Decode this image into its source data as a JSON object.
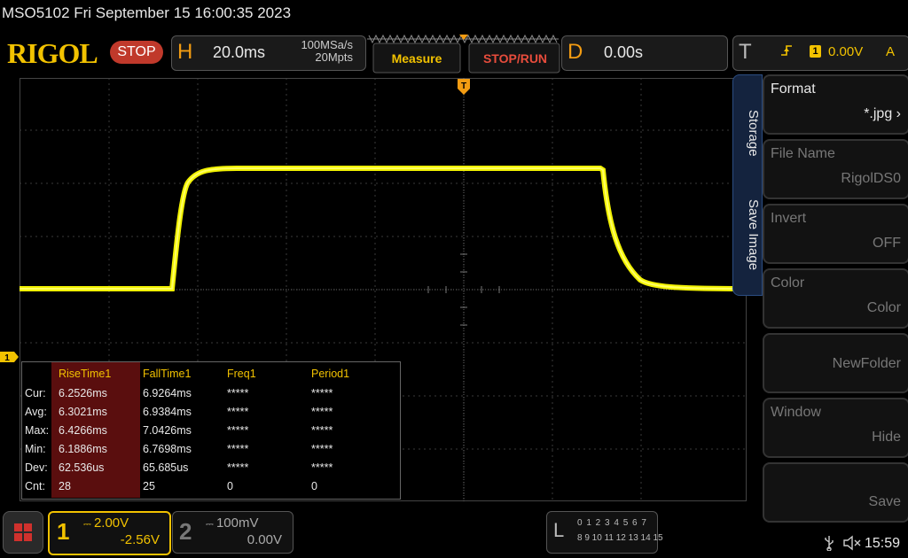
{
  "title": "MSO5102  Fri September 15 16:00:35 2023",
  "topbar": {
    "logo": "RIGOL",
    "run_state": "STOP",
    "horizontal": {
      "letter": "H",
      "timebase": "20.0ms",
      "sample_rate": "100MSa/s",
      "memory_depth": "20Mpts"
    },
    "measure_label": "Measure",
    "stop_run_label": "STOP/RUN",
    "delay": {
      "letter": "D",
      "value": "0.00s"
    },
    "trigger": {
      "letter": "T",
      "edge_symbol": "⫯",
      "channel": "1",
      "level": "0.00V",
      "mode": "A"
    }
  },
  "side_panel": {
    "tabs": [
      "Storage",
      "Save Image"
    ],
    "buttons": [
      {
        "label": "Format",
        "value": "*.jpg",
        "enabled": true
      },
      {
        "label": "File Name",
        "value": "RigolDS0",
        "enabled": false
      },
      {
        "label": "Invert",
        "value": "OFF",
        "enabled": false
      },
      {
        "label": "Color",
        "value": "Color",
        "enabled": false
      },
      {
        "label": "",
        "value": "NewFolder",
        "enabled": false
      },
      {
        "label": "Window",
        "value": "Hide",
        "enabled": false
      },
      {
        "label": "",
        "value": "Save",
        "enabled": false
      }
    ]
  },
  "measurements": {
    "headers": [
      "RiseTime1",
      "FallTime1",
      "Freq1",
      "Period1"
    ],
    "rows": [
      {
        "label": "Cur:",
        "values": [
          "6.2526ms",
          "6.9264ms",
          "*****",
          "*****"
        ]
      },
      {
        "label": "Avg:",
        "values": [
          "6.3021ms",
          "6.9384ms",
          "*****",
          "*****"
        ]
      },
      {
        "label": "Max:",
        "values": [
          "6.4266ms",
          "7.0426ms",
          "*****",
          "*****"
        ]
      },
      {
        "label": "Min:",
        "values": [
          "6.1886ms",
          "6.7698ms",
          "*****",
          "*****"
        ]
      },
      {
        "label": "Dev:",
        "values": [
          "62.536us",
          "65.685us",
          "*****",
          "*****"
        ]
      },
      {
        "label": "Cnt:",
        "values": [
          "28",
          "25",
          "0",
          "0"
        ]
      }
    ]
  },
  "channels": {
    "ch1": {
      "number": "1",
      "scale": "2.00V",
      "offset": "-2.56V",
      "color": "#f2c200",
      "marker": "1"
    },
    "ch2": {
      "number": "2",
      "scale": "100mV",
      "offset": "0.00V"
    }
  },
  "logic": {
    "letter": "L",
    "row1": "0 1 2 3  4 5 6 7",
    "row2": "8 9 10 11 12 13 14 15"
  },
  "status": {
    "clock": "15:59",
    "usb_icon": "usb-icon",
    "speaker_icon": "speaker-muted-icon"
  },
  "colors": {
    "accent": "#f2c200",
    "stop": "#c0392b",
    "trace": "#ffff00",
    "grid": "#444444"
  }
}
